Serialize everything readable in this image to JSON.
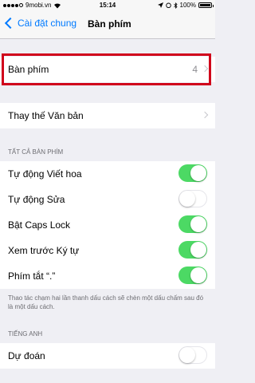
{
  "status_bar": {
    "carrier": "9mobi.vn",
    "time": "15:14",
    "battery": "100%"
  },
  "nav": {
    "back_label": "Cài đặt chung",
    "title": "Bàn phím"
  },
  "keyboards_row": {
    "label": "Bàn phím",
    "value": "4"
  },
  "text_replacement_row": {
    "label": "Thay thế Văn bản"
  },
  "all_keyboards": {
    "header": "TẤT CẢ BÀN PHÍM",
    "items": [
      {
        "label": "Tự động Viết hoa",
        "on": true
      },
      {
        "label": "Tự động Sửa",
        "on": false
      },
      {
        "label": "Bật Caps Lock",
        "on": true
      },
      {
        "label": "Xem trước Ký tự",
        "on": true
      },
      {
        "label": "Phím tắt “.”",
        "on": true
      }
    ],
    "footer": "Thao tác chạm hai lần thanh dấu cách sẽ chèn một dấu chấm sau đó là một dấu cách."
  },
  "english": {
    "header": "TIẾNG ANH",
    "items": [
      {
        "label": "Dự đoán",
        "on": false
      }
    ]
  },
  "colors": {
    "accent": "#007aff",
    "toggle_on": "#4cd964",
    "highlight": "#d0021b"
  }
}
